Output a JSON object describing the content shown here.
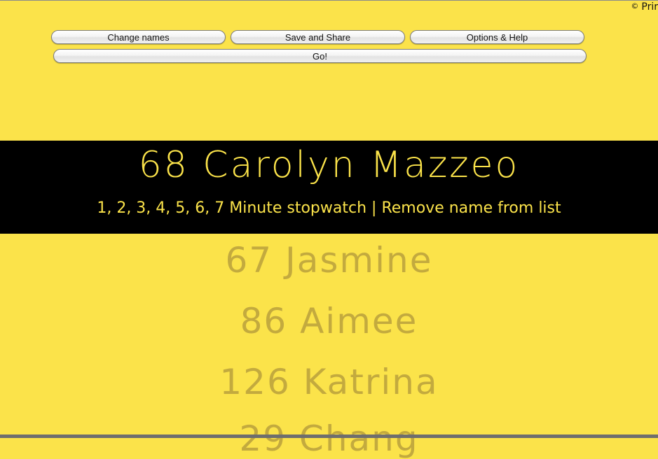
{
  "copyright": {
    "symbol": "©",
    "text": "Prir"
  },
  "toolbar": {
    "change_names": "Change names",
    "save_share": "Save and Share",
    "options_help": "Options & Help",
    "go": "Go!"
  },
  "current": {
    "name": "68 Carolyn Mazzeo",
    "stopwatch_numbers": "1, 2, 3, 4, 5, 6, 7",
    "stopwatch_label": "Minute stopwatch",
    "separator": "|",
    "remove_label": "Remove name from list"
  },
  "queue": [
    "67 Jasmine",
    "86 Aimee",
    "126 Katrina",
    "29 Chang"
  ],
  "colors": {
    "background": "#fbe34a",
    "band": "#000000",
    "highlight_text": "#fbe34a",
    "queue_text": "#c3aa3e"
  }
}
